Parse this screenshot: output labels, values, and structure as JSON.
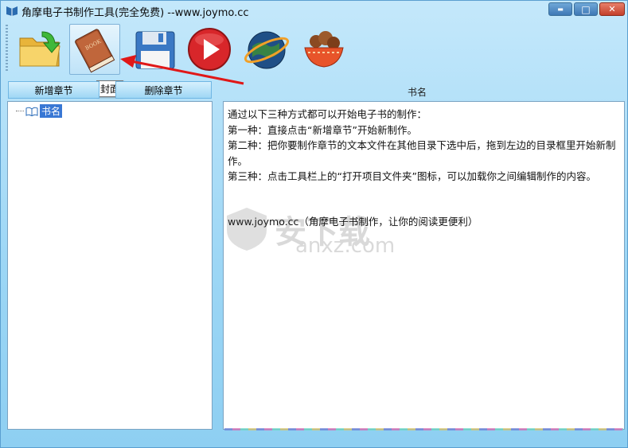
{
  "window": {
    "title": "角摩电子书制作工具(完全免费)  --www.joymo.cc",
    "controls": {
      "minimize": "▬",
      "maximize": "□",
      "close": "✕"
    }
  },
  "toolbar": {
    "tools": [
      {
        "name": "open-folder",
        "icon": "folder-arrow-icon"
      },
      {
        "name": "cover",
        "icon": "book-icon"
      },
      {
        "name": "save",
        "icon": "floppy-disk-icon"
      },
      {
        "name": "play",
        "icon": "play-icon"
      },
      {
        "name": "web",
        "icon": "globe-icon"
      },
      {
        "name": "bowl",
        "icon": "food-bowl-icon"
      }
    ],
    "tooltip": "封面"
  },
  "tabs": {
    "add_label": "新增章节",
    "delete_label": "删除章节"
  },
  "tree": {
    "root_label": "书名"
  },
  "content": {
    "heading": "书名",
    "text": "通过以下三种方式都可以开始电子书的制作：\n第一种：直接点击“新增章节”开始新制作。\n第二种：把你要制作章节的文本文件在其他目录下选中后，拖到左边的目录框里开始新制作。\n第三种：点击工具栏上的“打开项目文件夹”图标，可以加载你之间编辑制作的内容。",
    "link_line": "www.joymo.cc（角摩电子书制作，让你的阅读更便利）"
  },
  "watermark": {
    "cn": "安下载",
    "en": "anxz.com"
  },
  "colors": {
    "accent_arrow": "#e01818",
    "selection": "#3877d4"
  }
}
